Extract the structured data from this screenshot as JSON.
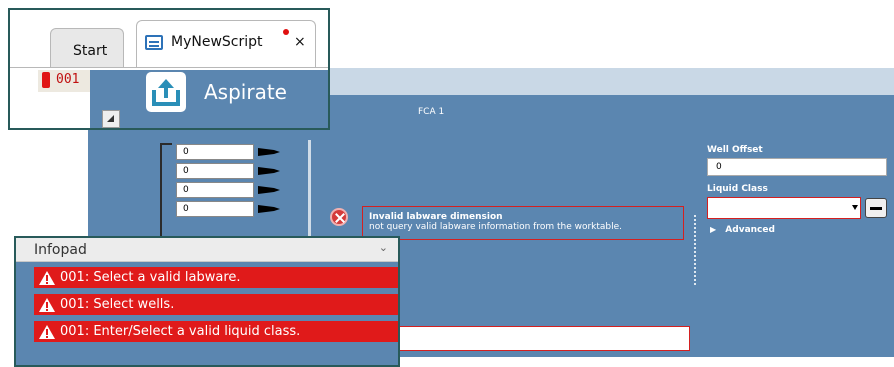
{
  "tabs": {
    "start_label": "Start",
    "script_label": "MyNewScript",
    "close_glyph": "×"
  },
  "step": {
    "number": "001",
    "command_title": "Aspirate"
  },
  "main": {
    "section_title": "FCA 1",
    "volumes": [
      "0",
      "0",
      "0",
      "0"
    ]
  },
  "error": {
    "title": "Invalid labware dimension",
    "message": "not query valid labware information from the worktable."
  },
  "right_panel": {
    "well_offset_label": "Well Offset",
    "well_offset_value": "0",
    "liquid_class_label": "Liquid Class",
    "liquid_class_value": "",
    "advanced_label": "Advanced"
  },
  "infopad": {
    "title": "Infopad",
    "messages": [
      "001: Select a valid labware.",
      "001: Select wells.",
      "001: Enter/Select a valid liquid class."
    ]
  },
  "colors": {
    "panel_blue": "#5b86b0",
    "error_red": "#e01a1a",
    "modified_dot": "#e01010"
  },
  "icons": {
    "doc": "script-document-icon",
    "aspirate": "aspirate-upload-icon",
    "warning": "warning-triangle-icon",
    "error": "error-x-icon",
    "tip": "pipette-tip-icon"
  }
}
